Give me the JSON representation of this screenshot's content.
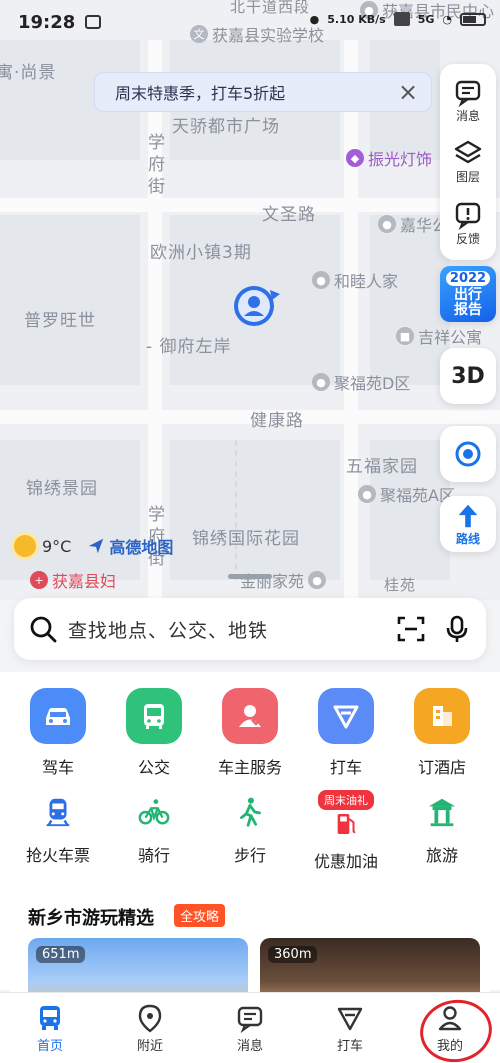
{
  "status_bar": {
    "time": "19:28",
    "net": "5.10 KB/s",
    "signal": "5G"
  },
  "promo": {
    "text": "周末特惠季，打车5折起"
  },
  "map": {
    "labels": {
      "top_road": "北干道西段",
      "school": "获嘉县实验学校",
      "gov": "获嘉县市民中心",
      "yujing": "寓·尚景",
      "tianjiao": "天骄都市广场",
      "xuefu": "学府街",
      "wensheng": "文圣路",
      "ouzhou": "欧洲小镇3期",
      "puluo": "普罗旺世",
      "yufu": "- 御府左岸",
      "jiankang": "健康路",
      "wufu": "五福家园",
      "jinxiu": "锦绣景园",
      "xuefu2": "学府街",
      "jinxiu_intl": "锦绣国际花园",
      "jinli": "金丽家苑",
      "taoyuan": "桂苑"
    },
    "pois": {
      "zhenguang": "振光灯饰",
      "jiahua": "嘉华公",
      "hemu": "和睦人家",
      "jixiang": "吉祥公寓",
      "jufu_d": "聚福苑D区",
      "jufu_a": "聚福苑A区",
      "hospital": "获嘉县妇"
    }
  },
  "tools": {
    "message": "消息",
    "layers": "图层",
    "feedback": "反馈",
    "report_year": "2022",
    "report_line1": "出行",
    "report_line2": "报告",
    "three_d": "3D",
    "route": "路线"
  },
  "weather": {
    "temp": "9°C",
    "brand": "高德地图"
  },
  "search": {
    "placeholder": "查找地点、公交、地铁"
  },
  "services_row1": [
    {
      "label": "驾车",
      "icon": "car-icon",
      "color": "#4c8cf8"
    },
    {
      "label": "公交",
      "icon": "bus-icon",
      "color": "#2fc27a"
    },
    {
      "label": "车主服务",
      "icon": "owner-icon",
      "color": "#f0646e"
    },
    {
      "label": "打车",
      "icon": "taxi-icon",
      "color": "#5b8bf6"
    },
    {
      "label": "订酒店",
      "icon": "hotel-icon",
      "color": "#f5a623"
    }
  ],
  "services_row2": [
    {
      "label": "抢火车票",
      "icon": "train-icon"
    },
    {
      "label": "骑行",
      "icon": "bike-icon"
    },
    {
      "label": "步行",
      "icon": "walk-icon"
    },
    {
      "label": "优惠加油",
      "icon": "fuel-icon",
      "badge": "周末油礼"
    },
    {
      "label": "旅游",
      "icon": "travel-icon"
    }
  ],
  "recommend": {
    "title": "新乡市游玩精选",
    "tag": "全攻略",
    "cards": [
      {
        "distance": "651m"
      },
      {
        "distance": "360m"
      }
    ]
  },
  "tabbar": [
    {
      "label": "首页",
      "active": true
    },
    {
      "label": "附近"
    },
    {
      "label": "消息"
    },
    {
      "label": "打车"
    },
    {
      "label": "我的"
    }
  ]
}
